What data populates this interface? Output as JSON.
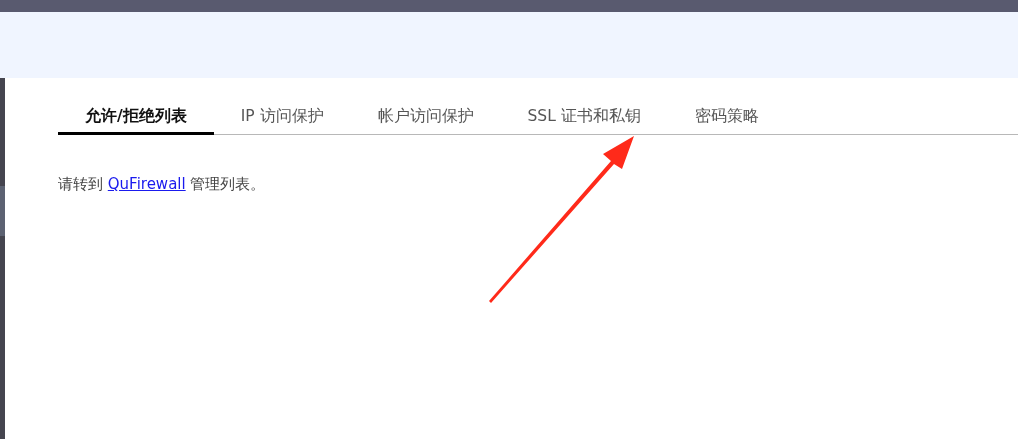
{
  "tabs": [
    {
      "label": "允许/拒绝列表",
      "selected": true
    },
    {
      "label": "IP 访问保护",
      "selected": false
    },
    {
      "label": "帐户访问保护",
      "selected": false
    },
    {
      "label": "SSL 证书和私钥",
      "selected": false
    },
    {
      "label": "密码策略",
      "selected": false
    }
  ],
  "message": {
    "before": "请转到",
    "link": "QuFirewall",
    "after": "管理列表。"
  }
}
